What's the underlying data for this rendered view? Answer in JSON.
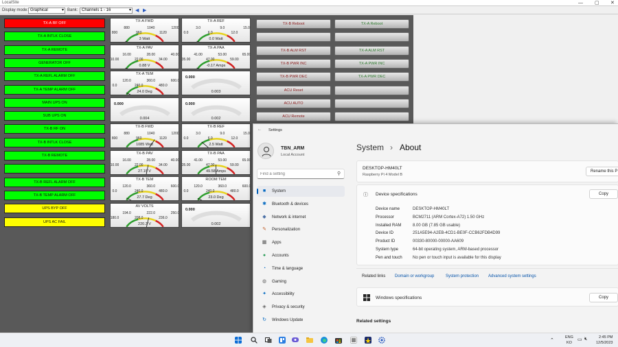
{
  "localsite": {
    "title": "LocalSite",
    "window_controls": {
      "minimize": "—",
      "maximize": "▢",
      "close": "✕"
    },
    "toolbar": {
      "display_mode_label": "Display mode:",
      "display_mode_value": "Graphical",
      "bank_label": "Bank:",
      "bank_value": "Channels 1 - 16",
      "prev": "◀",
      "next": "▶"
    },
    "status_buttons": [
      {
        "label": "TX-A RF OFF",
        "color": "red"
      },
      {
        "label": "TX-A INTLK CLOSE",
        "color": "green"
      },
      {
        "label": "TX-A REMOTE",
        "color": "green"
      },
      {
        "label": "GENERATOR  OFF",
        "color": "green"
      },
      {
        "label": "TX-A REFL ALARM OFF",
        "color": "green"
      },
      {
        "label": "TX-A TEMP ALARM OFF",
        "color": "green"
      },
      {
        "label": "MAIN UPS ON",
        "color": "green"
      },
      {
        "label": "SUB UPS ON",
        "color": "green"
      },
      {
        "label": "TX-B RF ON",
        "color": "green"
      },
      {
        "label": "TX-B INTLK CLOSE",
        "color": "green"
      },
      {
        "label": "TX-B REMOTE",
        "color": "green"
      },
      {
        "label": "",
        "color": "green"
      },
      {
        "label": "TX-B REFL ALARM OFF",
        "color": "green"
      },
      {
        "label": "TX-B TEMP ALARM OFF",
        "color": "green"
      },
      {
        "label": "UPS BYP OFF",
        "color": "yellow"
      },
      {
        "label": "UPS AC FAIL",
        "color": "yellow"
      }
    ],
    "meters": [
      {
        "title": "TX-A FWD",
        "scale": [
          "800",
          "880",
          "960",
          "1040",
          "1120",
          "1200"
        ],
        "value": "3 Watt",
        "fraction": 0.0
      },
      {
        "title": "TX-A REF",
        "scale": [
          "0.0",
          "3.0",
          "6.0",
          "9.0",
          "12.0",
          "15.0"
        ],
        "value": "0.0 Watt",
        "fraction": 0.0
      },
      {
        "title": "TX-A PAV",
        "scale": [
          "10.00",
          "16.00",
          "22.00",
          "28.00",
          "34.00",
          "40.00"
        ],
        "value": "0.88 V",
        "fraction": 0.0
      },
      {
        "title": "TX-A PAA",
        "scale": [
          "35.00",
          "41.00",
          "47.00",
          "53.00",
          "59.00",
          "65.00"
        ],
        "value": "-0.17 Amps",
        "fraction": 0.0
      },
      {
        "title": "TX-A TEM",
        "scale": [
          "0.0",
          "120.0",
          "240.0",
          "360.0",
          "480.0",
          "600.0"
        ],
        "value": "24.0 Deg",
        "fraction": 0.04
      },
      {
        "title": "",
        "scale": [
          "0.000"
        ],
        "value": "0.003",
        "fraction": 0.0,
        "blank": true
      },
      {
        "title": "",
        "scale": [
          "0.000"
        ],
        "value": "0.004",
        "fraction": 0.0,
        "blank": true
      },
      {
        "title": "",
        "scale": [
          "0.000"
        ],
        "value": "0.002",
        "fraction": 0.0,
        "blank": true
      },
      {
        "title": "TX-B FWD",
        "scale": [
          "800",
          "880",
          "960",
          "1040",
          "1120",
          "1200"
        ],
        "value": "1085 Watt",
        "fraction": 0.71
      },
      {
        "title": "TX-B REF",
        "scale": [
          "0.0",
          "3.0",
          "6.0",
          "9.0",
          "12.0",
          "15.0"
        ],
        "value": "2.5 Watt",
        "fraction": 0.17
      },
      {
        "title": "TX-B PAV",
        "scale": [
          "10.00",
          "16.00",
          "22.00",
          "28.00",
          "34.00",
          "40.00"
        ],
        "value": "27.15 V",
        "fraction": 0.57
      },
      {
        "title": "TX-B PAA",
        "scale": [
          "35.00",
          "41.00",
          "47.00",
          "53.00",
          "59.00",
          "65.00"
        ],
        "value": "49.58 Amps",
        "fraction": 0.49
      },
      {
        "title": "TX-B TEM",
        "scale": [
          "0.0",
          "120.0",
          "240.0",
          "360.0",
          "480.0",
          "600.0"
        ],
        "value": "27.7 Deg",
        "fraction": 0.05
      },
      {
        "title": "ROOM TEM",
        "scale": [
          "0.0",
          "120.0",
          "240.0",
          "360.0",
          "480.0",
          "600.0"
        ],
        "value": "23.0 Deg",
        "fraction": 0.04
      },
      {
        "title": "AV VOLTS",
        "scale": [
          "180.0",
          "194.0",
          "208.0",
          "222.0",
          "236.0",
          "250.0"
        ],
        "value": "220.3 V",
        "fraction": 0.58
      },
      {
        "title": "",
        "scale": [
          "0.000"
        ],
        "value": "0.002",
        "fraction": 0.0,
        "blank": true
      }
    ],
    "device_buttons": [
      [
        "TX-B Reboot",
        "TX-A  Reboot"
      ],
      [
        "",
        ""
      ],
      [
        "TX-B ALM RST",
        "TX-A ALM RST"
      ],
      [
        "TX-B PWR INC",
        "TX-A PWR INC"
      ],
      [
        "TX-B PWR DEC",
        "TX-A PWR DEC"
      ],
      [
        "ACU Reset",
        ""
      ],
      [
        "ACU AUTO",
        ""
      ],
      [
        "ACU Remote",
        ""
      ]
    ]
  },
  "settings": {
    "app_title": "Settings",
    "user_name": "TBN_ARM",
    "account_type": "Local Account",
    "search_placeholder": "Find a setting",
    "nav": [
      {
        "label": "System",
        "icon": "■",
        "icon_color": "#0067c0"
      },
      {
        "label": "Bluetooth & devices",
        "icon": "✱",
        "icon_color": "#0067c0"
      },
      {
        "label": "Network & internet",
        "icon": "◆",
        "icon_color": "#4a6fa5"
      },
      {
        "label": "Personalization",
        "icon": "✎",
        "icon_color": "#c0602a"
      },
      {
        "label": "Apps",
        "icon": "▦",
        "icon_color": "#555"
      },
      {
        "label": "Accounts",
        "icon": "●",
        "icon_color": "#2e9e5b"
      },
      {
        "label": "Time & language",
        "icon": "◔",
        "icon_color": "#0067c0"
      },
      {
        "label": "Gaming",
        "icon": "◍",
        "icon_color": "#666"
      },
      {
        "label": "Accessibility",
        "icon": "✦",
        "icon_color": "#0067c0"
      },
      {
        "label": "Privacy & security",
        "icon": "◈",
        "icon_color": "#666"
      },
      {
        "label": "Windows Update",
        "icon": "↻",
        "icon_color": "#0067c0"
      }
    ],
    "breadcrumb_parent": "System",
    "breadcrumb_sep": "›",
    "breadcrumb_current": "About",
    "device_name": "DESKTOP-HM40LT",
    "device_model": "Raspberry Pi 4 Model B",
    "rename_label": "Rename this P",
    "device_spec_title": "Device specifications",
    "copy_label": "Copy",
    "specs": [
      {
        "label": "Device name",
        "value": "DESKTOP-HM40LT"
      },
      {
        "label": "Processor",
        "value": "BCM2711 (ARM Cortex-A72)   1.50 GHz"
      },
      {
        "label": "Installed RAM",
        "value": "8.00 GB (7.85 GB usable)"
      },
      {
        "label": "Device ID",
        "value": "251A5E94-A2EB-4CD1-BE0F-CCB62FDB4D99"
      },
      {
        "label": "Product ID",
        "value": "00330-80000-00000-AA609"
      },
      {
        "label": "System type",
        "value": "64-bit operating system, ARM-based processor"
      },
      {
        "label": "Pen and touch",
        "value": "No pen or touch input is available for this display"
      }
    ],
    "related_links_label": "Related links",
    "related_links": [
      "Domain or workgroup",
      "System protection",
      "Advanced system settings"
    ],
    "windows_spec_title": "Windows specifications",
    "related_settings": "Related settings"
  },
  "taskbar": {
    "lang_top": "ENG",
    "lang_bottom": "KO",
    "time": "2:45 PM",
    "date": "12/5/2023"
  }
}
